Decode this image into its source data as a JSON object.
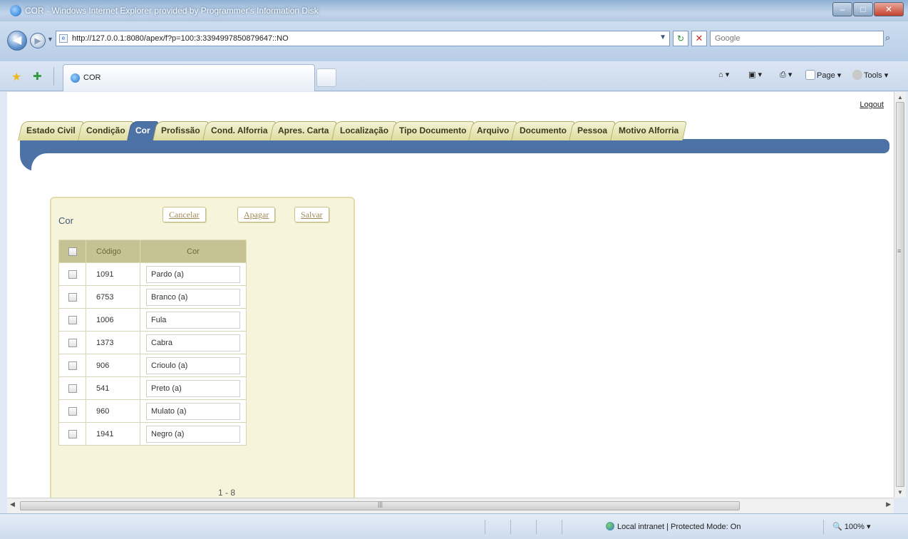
{
  "window": {
    "title": "COR - Windows Internet Explorer provided by Programmer's Information Disk",
    "controls": {
      "minimize": "–",
      "maximize": "□",
      "close": "✕"
    }
  },
  "address": {
    "url": "http://127.0.0.1:8080/apex/f?p=100:3:3394997850879647::NO",
    "search_placeholder": "Google"
  },
  "browser_tab": {
    "label": "COR"
  },
  "command_bar": {
    "page_label": "Page ▾",
    "tools_label": "Tools ▾"
  },
  "page": {
    "logout": "Logout",
    "tabs": [
      {
        "label": "Estado Civil",
        "active": false
      },
      {
        "label": "Condição",
        "active": false
      },
      {
        "label": "Cor",
        "active": true
      },
      {
        "label": "Profissão",
        "active": false
      },
      {
        "label": "Cond. Alforria",
        "active": false
      },
      {
        "label": "Apres. Carta",
        "active": false
      },
      {
        "label": "Localização",
        "active": false
      },
      {
        "label": "Tipo Documento",
        "active": false
      },
      {
        "label": "Arquivo",
        "active": false
      },
      {
        "label": "Documento",
        "active": false
      },
      {
        "label": "Pessoa",
        "active": false
      },
      {
        "label": "Motivo Alforria",
        "active": false
      }
    ],
    "region": {
      "title": "Cor",
      "buttons": {
        "cancel": "Cancelar",
        "delete": "Apagar",
        "save": "Salvar"
      },
      "columns": {
        "code": "Código",
        "name": "Cor"
      },
      "rows": [
        {
          "code": "1091",
          "name": "Pardo (a)"
        },
        {
          "code": "6753",
          "name": "Branco (a)"
        },
        {
          "code": "1006",
          "name": "Fula"
        },
        {
          "code": "1373",
          "name": "Cabra"
        },
        {
          "code": "906",
          "name": "Crioulo (a)"
        },
        {
          "code": "541",
          "name": "Preto (a)"
        },
        {
          "code": "960",
          "name": "Mulato (a)"
        },
        {
          "code": "1941",
          "name": "Negro (a)"
        }
      ],
      "pagination": "1 - 8"
    }
  },
  "status": {
    "zone": "Local intranet | Protected Mode: On",
    "zoom": "100%"
  },
  "colors": {
    "accent": "#4d72a6",
    "tab_bg": "#e6e4b4",
    "region_bg": "#f6f4da",
    "grid_header": "#c5c293"
  }
}
